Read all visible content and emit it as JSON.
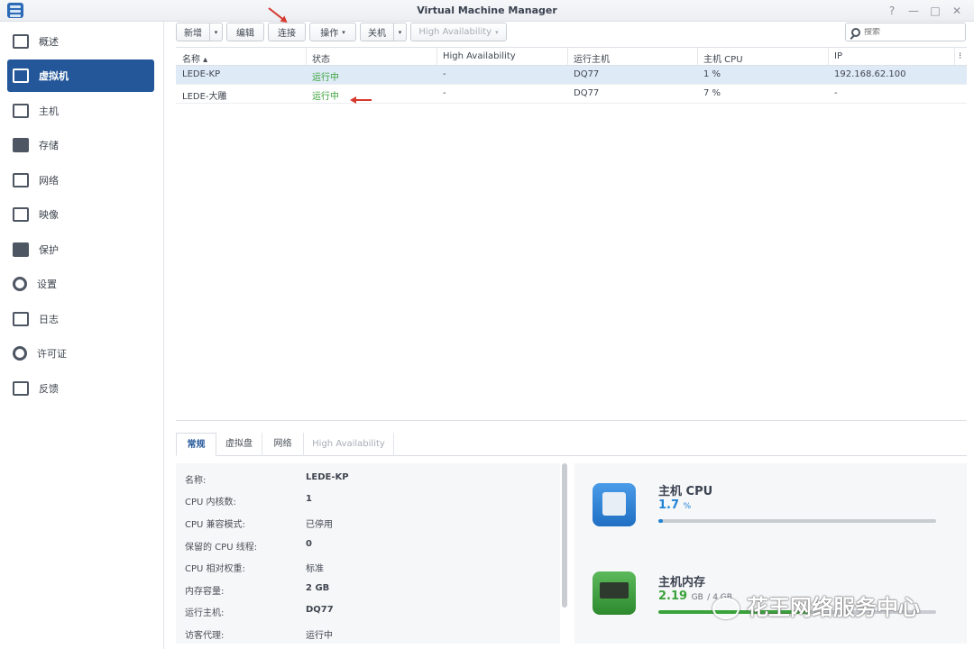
{
  "window": {
    "title": "Virtual Machine Manager",
    "controls": {
      "help": "?",
      "minimize": "—",
      "maximize": "□",
      "close": "✕"
    }
  },
  "sidebar": {
    "items": [
      {
        "label": "概述",
        "icon": "overview-icon"
      },
      {
        "label": "虚拟机",
        "icon": "virtual-machine-icon",
        "active": true
      },
      {
        "label": "主机",
        "icon": "host-icon"
      },
      {
        "label": "存储",
        "icon": "storage-icon"
      },
      {
        "label": "网络",
        "icon": "network-icon"
      },
      {
        "label": "映像",
        "icon": "image-icon"
      },
      {
        "label": "保护",
        "icon": "protection-icon"
      },
      {
        "label": "设置",
        "icon": "settings-icon"
      },
      {
        "label": "日志",
        "icon": "log-icon"
      },
      {
        "label": "许可证",
        "icon": "license-key-icon"
      },
      {
        "label": "反馈",
        "icon": "feedback-icon"
      }
    ]
  },
  "toolbar": {
    "create": "新增",
    "edit": "编辑",
    "connect": "连接",
    "action": "操作",
    "shutdown": "关机",
    "ha": "High Availability",
    "search_placeholder": "搜索"
  },
  "grid": {
    "columns": {
      "name": "名称 ▴",
      "status": "状态",
      "ha": "High Availability",
      "host": "运行主机",
      "cpu": "主机 CPU",
      "ip": "IP"
    },
    "rows": [
      {
        "name": "LEDE-KP",
        "status": "运行中",
        "ha": "-",
        "host": "DQ77",
        "cpu": "1 %",
        "ip": "192.168.62.100"
      },
      {
        "name": "LEDE-大雕",
        "status": "运行中",
        "ha": "-",
        "host": "DQ77",
        "cpu": "7 %",
        "ip": "-"
      }
    ]
  },
  "tabs": {
    "general": "常规",
    "vdisk": "虚拟盘",
    "network": "网络",
    "ha": "High Availability"
  },
  "details": [
    {
      "key": "名称:",
      "value": "LEDE-KP",
      "bold": true
    },
    {
      "key": "CPU 内核数:",
      "value": "1",
      "bold": true
    },
    {
      "key": "CPU 兼容模式:",
      "value": "已停用"
    },
    {
      "key": "保留的 CPU 线程:",
      "value": "0",
      "bold": true
    },
    {
      "key": "CPU 相对权重:",
      "value": "标准"
    },
    {
      "key": "内存容量:",
      "value": "2 GB",
      "bold": true
    },
    {
      "key": "运行主机:",
      "value": "DQ77",
      "bold": true
    },
    {
      "key": "访客代理:",
      "value": "运行中"
    }
  ],
  "resources": {
    "cpu": {
      "title": "主机 CPU",
      "value": "1.7",
      "unit": "%",
      "percent": 1.7,
      "color": "#1f83d6"
    },
    "memory": {
      "title": "主机内存",
      "value": "2.19",
      "unit": "GB",
      "suffix": "/ 4 GB",
      "percent": 55,
      "color": "#3aa23a"
    }
  },
  "watermark": "花王网络服务中心"
}
